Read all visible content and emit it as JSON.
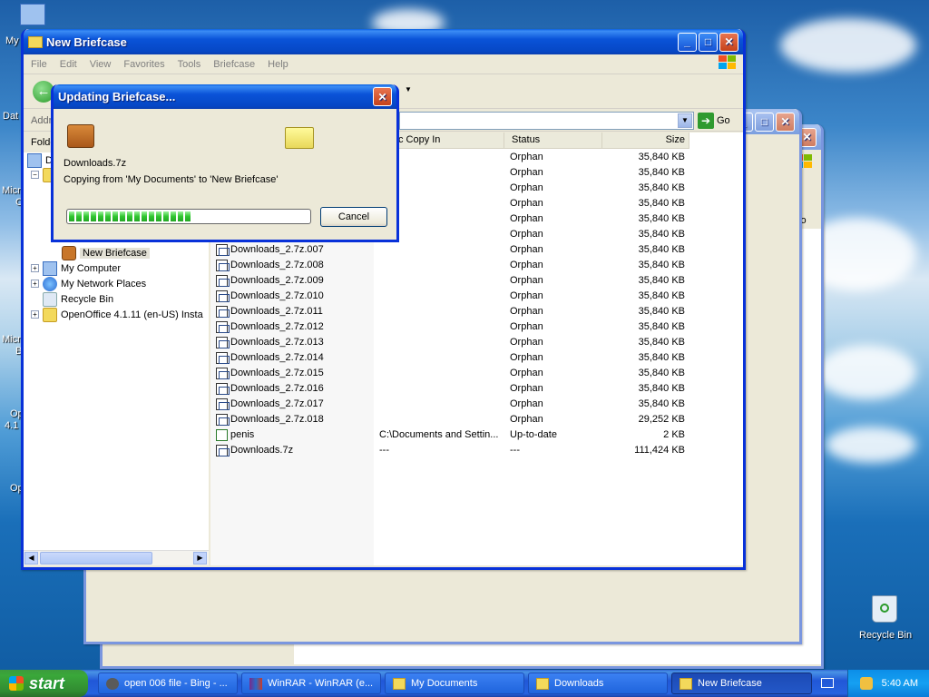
{
  "desktop": {
    "left_labels": [
      "My",
      "Dat",
      "Micro",
      "C",
      "Micro",
      "B",
      "Op",
      "4.1",
      "Op"
    ],
    "recycle_bin_label": "Recycle Bin"
  },
  "back_windows": {
    "go_label": "Go"
  },
  "main_window": {
    "title": "New Briefcase",
    "menu": [
      "File",
      "Edit",
      "View",
      "Favorites",
      "Tools",
      "Briefcase",
      "Help"
    ],
    "address_label": "Addr",
    "go_label": "Go",
    "folders_label": "Folde",
    "tree": [
      {
        "label": "D",
        "expander": "",
        "icon": "desktop",
        "indent": 0
      },
      {
        "label": "",
        "expander": "−",
        "icon": "folder",
        "indent": 1
      },
      {
        "label": "New Briefcase",
        "expander": "",
        "icon": "briefcase",
        "indent": 2,
        "selected": true
      },
      {
        "label": "My Computer",
        "expander": "+",
        "icon": "computer",
        "indent": 1
      },
      {
        "label": "My Network Places",
        "expander": "+",
        "icon": "network",
        "indent": 1
      },
      {
        "label": "Recycle Bin",
        "expander": "",
        "icon": "bin",
        "indent": 1
      },
      {
        "label": "OpenOffice 4.1.11 (en-US) Insta",
        "expander": "+",
        "icon": "folder",
        "indent": 1
      }
    ],
    "columns": [
      "Sync Copy In",
      "Status",
      "Size"
    ],
    "rows": [
      {
        "name": "",
        "sync": "",
        "status": "Orphan",
        "size": "35,840 KB",
        "icon": "file"
      },
      {
        "name": "",
        "sync": "",
        "status": "Orphan",
        "size": "35,840 KB",
        "icon": "file"
      },
      {
        "name": "",
        "sync": "",
        "status": "Orphan",
        "size": "35,840 KB",
        "icon": "file"
      },
      {
        "name": "",
        "sync": "",
        "status": "Orphan",
        "size": "35,840 KB",
        "icon": "file"
      },
      {
        "name": "",
        "sync": "",
        "status": "Orphan",
        "size": "35,840 KB",
        "icon": "file"
      },
      {
        "name": "",
        "sync": "",
        "status": "Orphan",
        "size": "35,840 KB",
        "icon": "file"
      },
      {
        "name": "Downloads_2.7z.007",
        "sync": "",
        "status": "Orphan",
        "size": "35,840 KB",
        "icon": "file"
      },
      {
        "name": "Downloads_2.7z.008",
        "sync": "",
        "status": "Orphan",
        "size": "35,840 KB",
        "icon": "file"
      },
      {
        "name": "Downloads_2.7z.009",
        "sync": "",
        "status": "Orphan",
        "size": "35,840 KB",
        "icon": "file"
      },
      {
        "name": "Downloads_2.7z.010",
        "sync": "",
        "status": "Orphan",
        "size": "35,840 KB",
        "icon": "file"
      },
      {
        "name": "Downloads_2.7z.011",
        "sync": "",
        "status": "Orphan",
        "size": "35,840 KB",
        "icon": "file"
      },
      {
        "name": "Downloads_2.7z.012",
        "sync": "",
        "status": "Orphan",
        "size": "35,840 KB",
        "icon": "file"
      },
      {
        "name": "Downloads_2.7z.013",
        "sync": "",
        "status": "Orphan",
        "size": "35,840 KB",
        "icon": "file"
      },
      {
        "name": "Downloads_2.7z.014",
        "sync": "",
        "status": "Orphan",
        "size": "35,840 KB",
        "icon": "file"
      },
      {
        "name": "Downloads_2.7z.015",
        "sync": "",
        "status": "Orphan",
        "size": "35,840 KB",
        "icon": "file"
      },
      {
        "name": "Downloads_2.7z.016",
        "sync": "",
        "status": "Orphan",
        "size": "35,840 KB",
        "icon": "file"
      },
      {
        "name": "Downloads_2.7z.017",
        "sync": "",
        "status": "Orphan",
        "size": "35,840 KB",
        "icon": "file"
      },
      {
        "name": "Downloads_2.7z.018",
        "sync": "",
        "status": "Orphan",
        "size": "29,252 KB",
        "icon": "file"
      },
      {
        "name": "penis",
        "sync": "C:\\Documents and Settin...",
        "status": "Up-to-date",
        "size": "2 KB",
        "icon": "text"
      },
      {
        "name": "Downloads.7z",
        "sync": "---",
        "status": "---",
        "size": "111,424 KB",
        "icon": "file"
      }
    ]
  },
  "dialog": {
    "title": "Updating Briefcase...",
    "file_name": "Downloads.7z",
    "copy_text": "Copying from 'My Documents' to 'New Briefcase'",
    "progress_fraction": 0.52,
    "cancel_label": "Cancel"
  },
  "taskbar": {
    "start_label": "start",
    "tasks": [
      {
        "label": "open 006 file - Bing - ...",
        "icon": "browser-icon",
        "active": false
      },
      {
        "label": "WinRAR - WinRAR (e...",
        "icon": "winrar-icon",
        "active": false
      },
      {
        "label": "My Documents",
        "icon": "folder-icon",
        "active": false
      },
      {
        "label": "Downloads",
        "icon": "folder-icon",
        "active": false
      },
      {
        "label": "New Briefcase",
        "icon": "folder-icon",
        "active": true
      }
    ],
    "clock": "5:40 AM"
  }
}
